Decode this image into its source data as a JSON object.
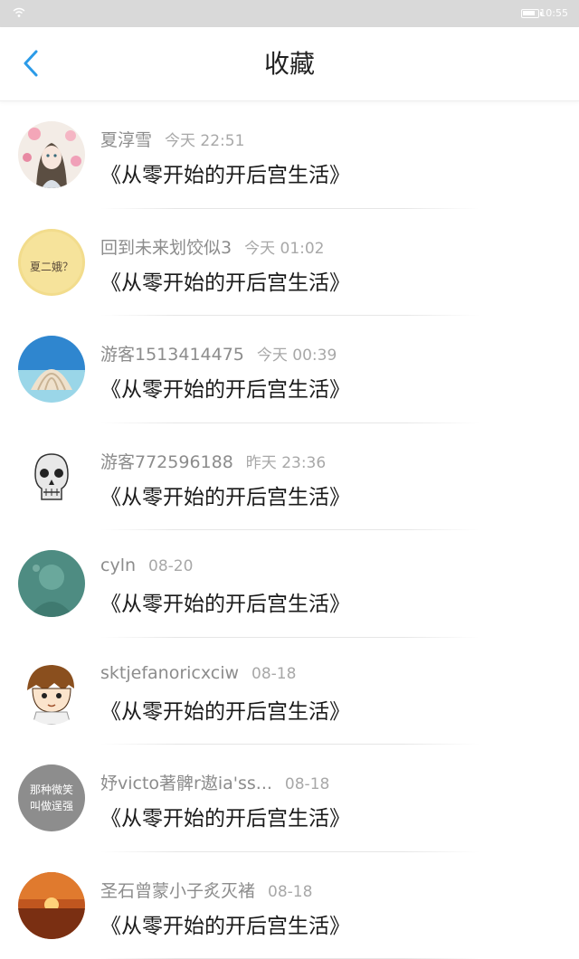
{
  "status_bar": {
    "time": "10:55"
  },
  "header": {
    "title": "收藏"
  },
  "items": [
    {
      "user": "夏淳雪",
      "time": "今天 22:51",
      "title": "《从零开始的开后宫生活》"
    },
    {
      "user": "回到未来划饺似3",
      "time": "今天 01:02",
      "title": "《从零开始的开后宫生活》",
      "avatar_text": "夏二娥？"
    },
    {
      "user": "游客1513414475",
      "time": "今天 00:39",
      "title": "《从零开始的开后宫生活》"
    },
    {
      "user": "游客772596188",
      "time": "昨天 23:36",
      "title": "《从零开始的开后宫生活》"
    },
    {
      "user": "cyln",
      "time": "08-20",
      "title": "《从零开始的开后宫生活》"
    },
    {
      "user": "sktjefanoricxciw",
      "time": "08-18",
      "title": "《从零开始的开后宫生活》"
    },
    {
      "user": "妤victo著髀r遨ia'ss...",
      "time": "08-18",
      "title": "《从零开始的开后宫生活》",
      "avatar_text_line1": "那种微笑",
      "avatar_text_line2": "叫做逞强"
    },
    {
      "user": "圣石曾蒙小子炙灭褚",
      "time": "08-18",
      "title": "《从零开始的开后宫生活》"
    }
  ]
}
